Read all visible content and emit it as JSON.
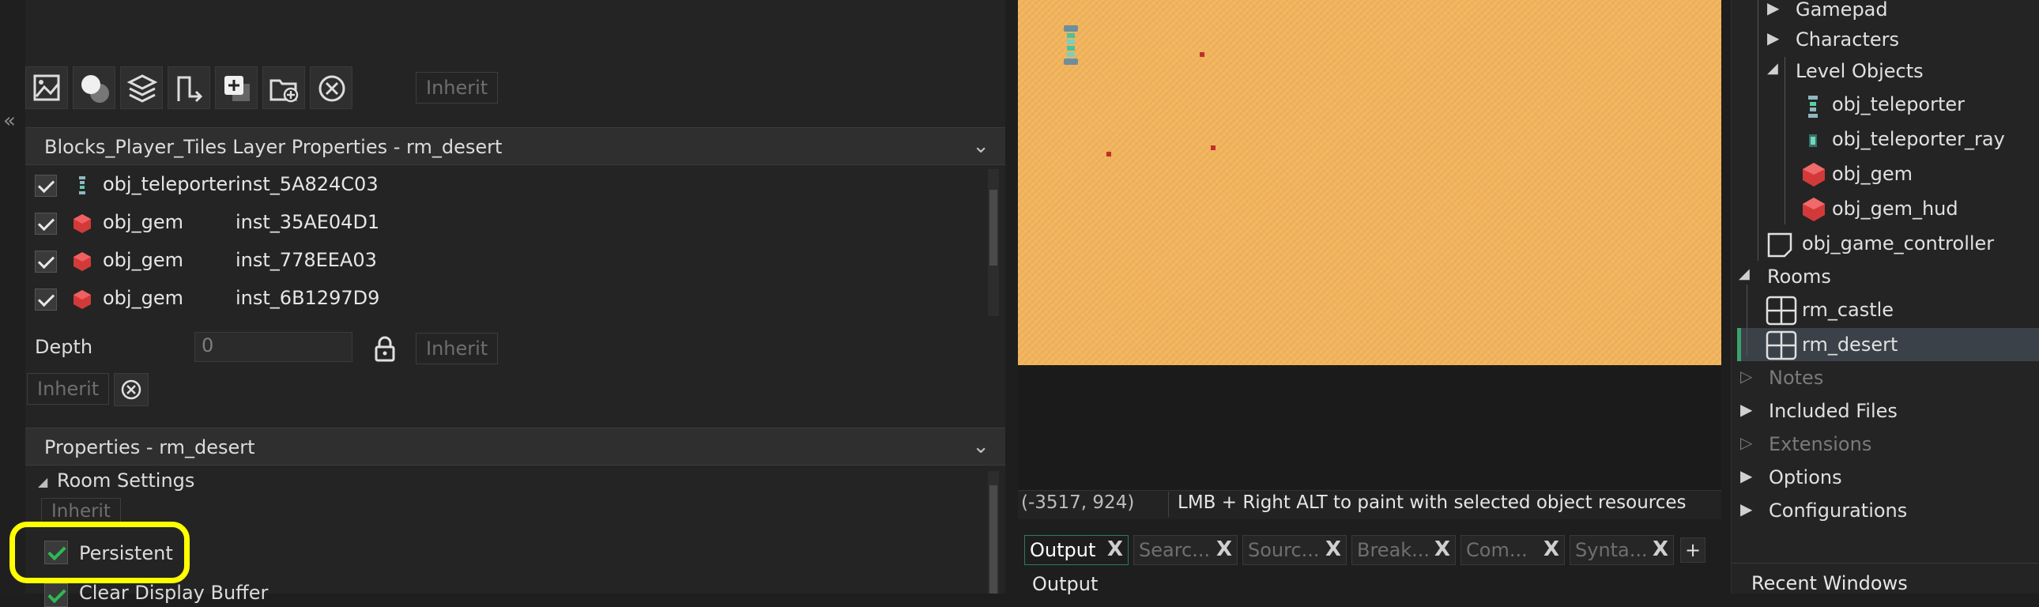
{
  "left_panel": {
    "toolbar": {
      "inherit_label": "Inherit",
      "icons": [
        "image-layer-icon",
        "background-layer-icon",
        "tile-layer-icon",
        "path-layer-icon",
        "add-instance-icon",
        "add-folder-icon",
        "delete-layer-icon"
      ]
    },
    "layer_properties": {
      "title": "Blocks_Player_Tiles Layer Properties - rm_desert",
      "instances": [
        {
          "object": "obj_teleporter",
          "instance": "inst_5A824C03"
        },
        {
          "object": "obj_gem",
          "instance": "inst_35AE04D1"
        },
        {
          "object": "obj_gem",
          "instance": "inst_778EEA03"
        },
        {
          "object": "obj_gem",
          "instance": "inst_6B1297D9"
        }
      ],
      "depth_label": "Depth",
      "depth_value": "0",
      "inherit_label": "Inherit",
      "inherit_label_2": "Inherit"
    },
    "room_properties": {
      "title": "Properties - rm_desert",
      "room_settings_label": "Room Settings",
      "inherit_label": "Inherit",
      "persistent_label": "Persistent",
      "clear_display_buffer_label": "Clear Display Buffer"
    },
    "collapse_glyph": "«"
  },
  "room_editor": {
    "coords": "(-3517, 924)",
    "hint": "LMB + Right ALT to paint with selected object resources"
  },
  "output": {
    "tabs": [
      {
        "label": "Output",
        "active": true
      },
      {
        "label": "Searc...",
        "active": false
      },
      {
        "label": "Sourc...",
        "active": false
      },
      {
        "label": "Break...",
        "active": false
      },
      {
        "label": "Com...",
        "active": false
      },
      {
        "label": "Synta...",
        "active": false
      }
    ],
    "close_glyph": "X",
    "add_glyph": "+",
    "panel_label": "Output"
  },
  "asset_browser": {
    "items": [
      {
        "label": "Gamepad",
        "type": "folder"
      },
      {
        "label": "Characters",
        "type": "folder"
      },
      {
        "label": "Level Objects",
        "type": "folder-open"
      },
      {
        "label": "obj_teleporter",
        "type": "object"
      },
      {
        "label": "obj_teleporter_ray",
        "type": "object"
      },
      {
        "label": "obj_gem",
        "type": "object"
      },
      {
        "label": "obj_gem_hud",
        "type": "object"
      },
      {
        "label": "obj_game_controller",
        "type": "object"
      },
      {
        "label": "Rooms",
        "type": "folder-open"
      },
      {
        "label": "rm_castle",
        "type": "room"
      },
      {
        "label": "rm_desert",
        "type": "room",
        "selected": true
      },
      {
        "label": "Notes",
        "type": "folder",
        "dim": true
      },
      {
        "label": "Included Files",
        "type": "folder"
      },
      {
        "label": "Extensions",
        "type": "folder",
        "dim": true
      },
      {
        "label": "Options",
        "type": "folder"
      },
      {
        "label": "Configurations",
        "type": "folder"
      }
    ],
    "recent_windows_label": "Recent Windows"
  },
  "colors": {
    "room_background": "#f2b45c",
    "highlight": "#ffff00",
    "selection": "#3b4149",
    "accent_green": "#3aa36b"
  }
}
